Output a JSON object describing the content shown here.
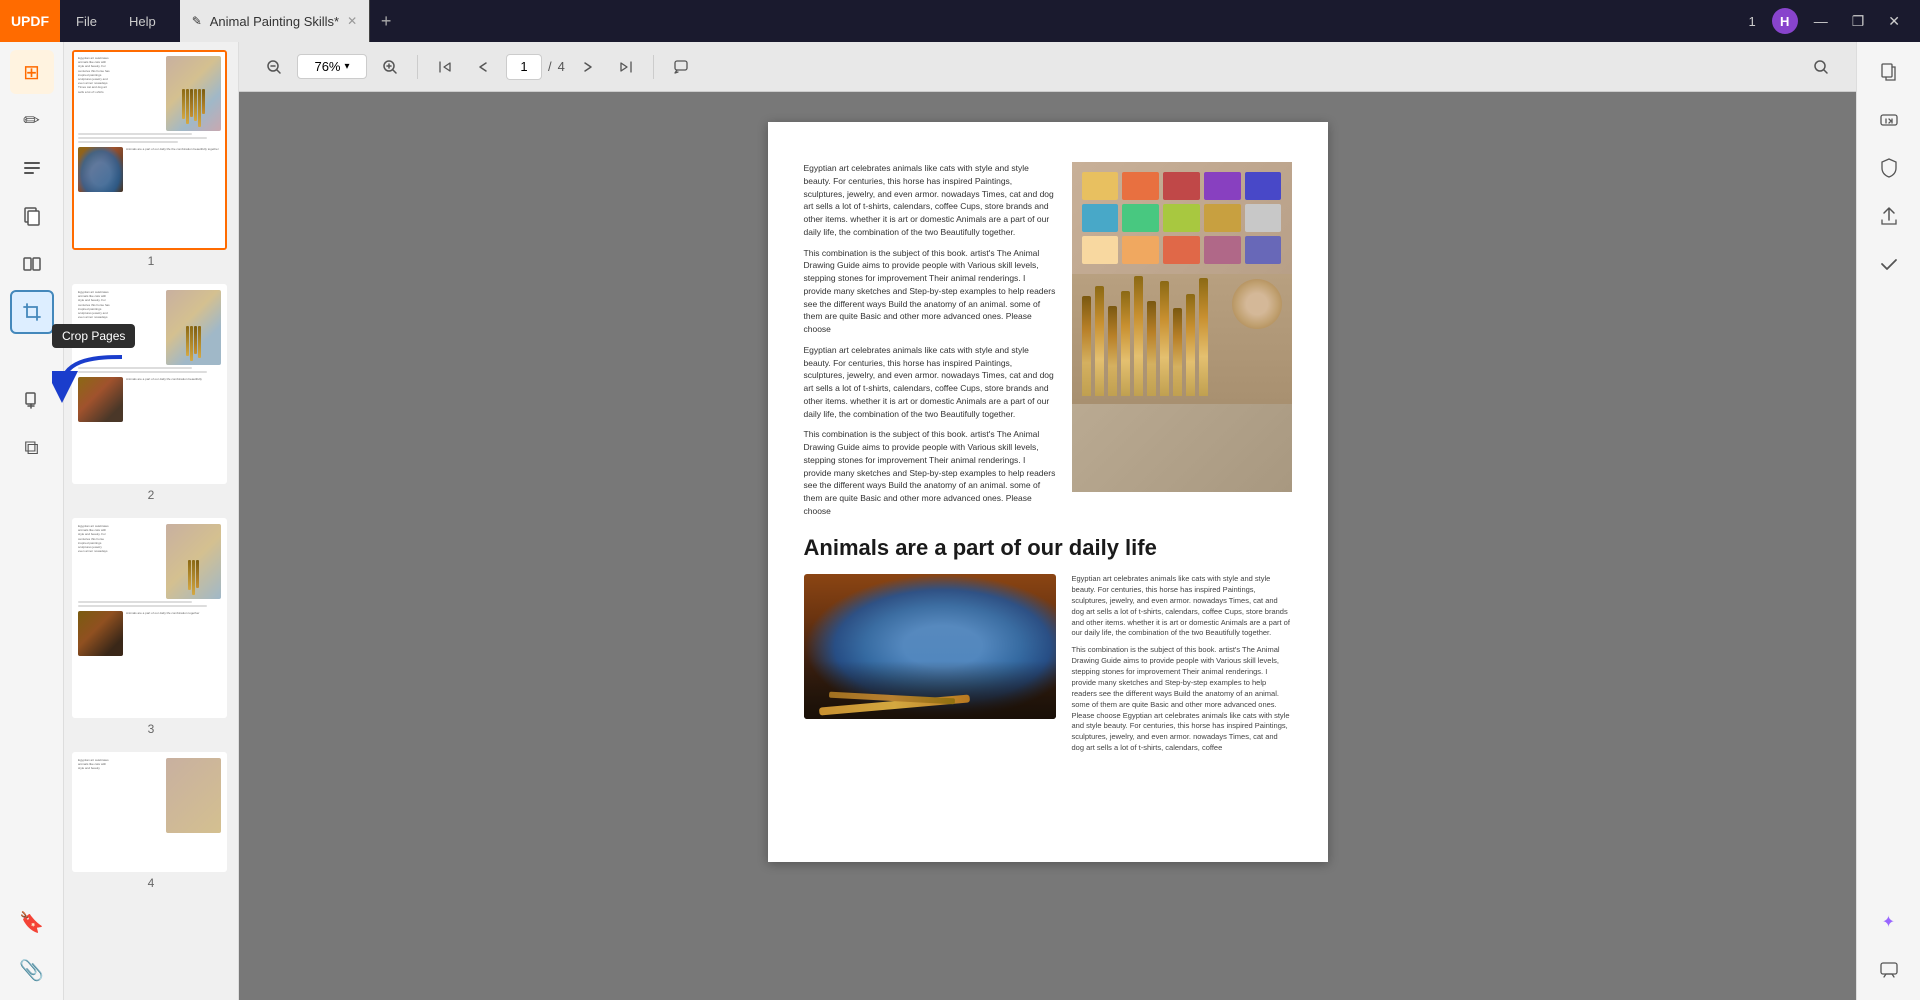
{
  "app": {
    "name": "UPDF",
    "title_bar": {
      "menu_items": [
        "File",
        "Help"
      ],
      "tab_name": "Animal Painting Skills*",
      "tab_icon": "edit-icon",
      "add_tab_label": "+",
      "window_controls": {
        "page_indicator": "1",
        "user_avatar": "H",
        "minimize": "—",
        "maximize": "❐",
        "close": "✕"
      }
    }
  },
  "toolbar": {
    "zoom_out": "−",
    "zoom_level": "76%",
    "zoom_in": "+",
    "nav_up_top": "⋀",
    "nav_up": "∧",
    "current_page": "1",
    "total_pages": "4",
    "nav_down": "∨",
    "nav_down_bottom": "⋁",
    "comment_icon": "💬",
    "search_icon": "🔍"
  },
  "sidebar_left": {
    "tools": [
      {
        "name": "grid-view-icon",
        "icon": "⊞",
        "active": true
      },
      {
        "name": "edit-text-icon",
        "icon": "✏"
      },
      {
        "name": "annotate-icon",
        "icon": "≡"
      },
      {
        "name": "pages-icon",
        "icon": "⊟"
      },
      {
        "name": "compare-icon",
        "icon": "≈"
      },
      {
        "name": "crop-icon",
        "icon": "⊡",
        "highlighted": true
      },
      {
        "name": "extract-icon",
        "icon": "⊕"
      },
      {
        "name": "layers-icon",
        "icon": "⧉"
      },
      {
        "name": "bookmark-icon",
        "icon": "🔖"
      },
      {
        "name": "attachment-icon",
        "icon": "📎"
      }
    ],
    "crop_tooltip": "Crop Pages"
  },
  "thumbnails": [
    {
      "page": "1",
      "active": true
    },
    {
      "page": "2",
      "active": false
    },
    {
      "page": "3",
      "active": false
    },
    {
      "page": "4",
      "active": false
    }
  ],
  "document": {
    "main_heading": "Animals are a part of our daily life",
    "body_text_1": "Egyptian art celebrates animals like cats with style and style beauty. For centuries, this horse has inspired Paintings, sculptures, jewelry, and even armor. nowadays Times, cat and dog art sells a lot of t-shirts, calendars, coffee Cups, store brands and other items. whether it is art or domestic Animals are a part of our daily life, the combination of the two Beautifully together.",
    "body_text_2": "This combination is the subject of this book. artist's The Animal Drawing Guide aims to provide people with Various skill levels, stepping stones for improvement Their animal renderings. I provide many sketches and Step-by-step examples to help readers see the different ways Build the anatomy of an animal. some of them are quite Basic and other more advanced ones. Please choose",
    "body_text_3": "Egyptian art celebrates animals like cats with style and style beauty. For centuries, this horse has inspired Paintings, sculptures, jewelry, and even armor. nowadays Times, cat and dog art sells a lot of t-shirts, calendars, coffee Cups, store brands and other items. whether it is art or domestic Animals are a part of our daily life, the combination of the two Beautifully together.",
    "body_text_4": "This combination is the subject of this book. artist's The Animal Drawing Guide aims to provide people with Various skill levels, stepping stones for improvement Their animal renderings. I provide many sketches and Step-by-step examples to help readers see the different ways Build the anatomy of an animal. some of them are quite Basic and other more advanced ones. Please choose",
    "right_col_text_1": "Egyptian art celebrates animals like cats with style and style beauty. For centuries, this horse has inspired Paintings, sculptures, jewelry, and even armor. nowadays Times, cat and dog art sells a lot of t-shirts, calendars, coffee Cups, store brands and other items. whether it is art or domestic Animals are a part of our daily life, the combination of the two Beautifully together.",
    "right_col_text_2": "This combination is the subject of this book. artist's The Animal Drawing Guide aims to provide people with Various skill levels, stepping stones for improvement Their animal renderings. I provide many sketches and Step-by-step examples to help readers see the different ways Build the anatomy of an animal. some of them are quite Basic and other more advanced ones. Please choose Egyptian art celebrates animals like cats with style and style beauty. For centuries, this horse has inspired Paintings, sculptures, jewelry, and even armor. nowadays Times, cat and dog art sells a lot of t-shirts, calendars, coffee"
  },
  "sidebar_right": {
    "tools": [
      {
        "name": "convert-icon",
        "icon": "⊞"
      },
      {
        "name": "ocr-icon",
        "icon": "T"
      },
      {
        "name": "protect-icon",
        "icon": "🔒"
      },
      {
        "name": "share-icon",
        "icon": "↑"
      },
      {
        "name": "check-icon",
        "icon": "✓"
      },
      {
        "name": "ai-icon",
        "icon": "✦"
      },
      {
        "name": "chat-icon",
        "icon": "💬"
      }
    ]
  },
  "colors": {
    "accent": "#ff6b00",
    "title_bar_bg": "#1a1a2e",
    "sidebar_bg": "#f5f5f5",
    "doc_bg": "#787878",
    "tab_active_bg": "#e8e8e8",
    "crop_highlight": "#4488bb"
  }
}
